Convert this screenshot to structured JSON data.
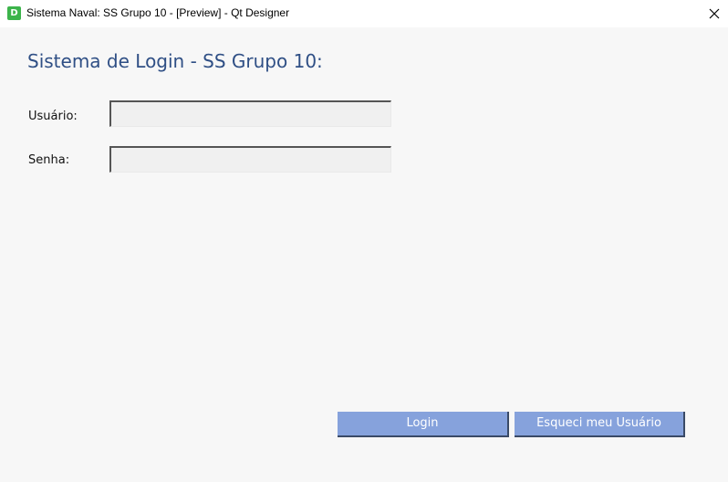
{
  "window": {
    "title": "Sistema Naval: SS Grupo 10 - [Preview] - Qt Designer",
    "app_icon_letter": "D",
    "app_icon_color": "#3cb44b"
  },
  "form": {
    "heading": "Sistema de Login - SS Grupo 10:",
    "heading_color": "#2f4f85",
    "username": {
      "label": "Usuário:",
      "value": ""
    },
    "password": {
      "label": "Senha:",
      "value": ""
    }
  },
  "buttons": {
    "login_label": "Login",
    "forgot_label": "Esqueci meu Usuário",
    "button_color": "#86a2dc"
  },
  "icons": {
    "app": "designer-app-icon",
    "close": "close-icon"
  }
}
